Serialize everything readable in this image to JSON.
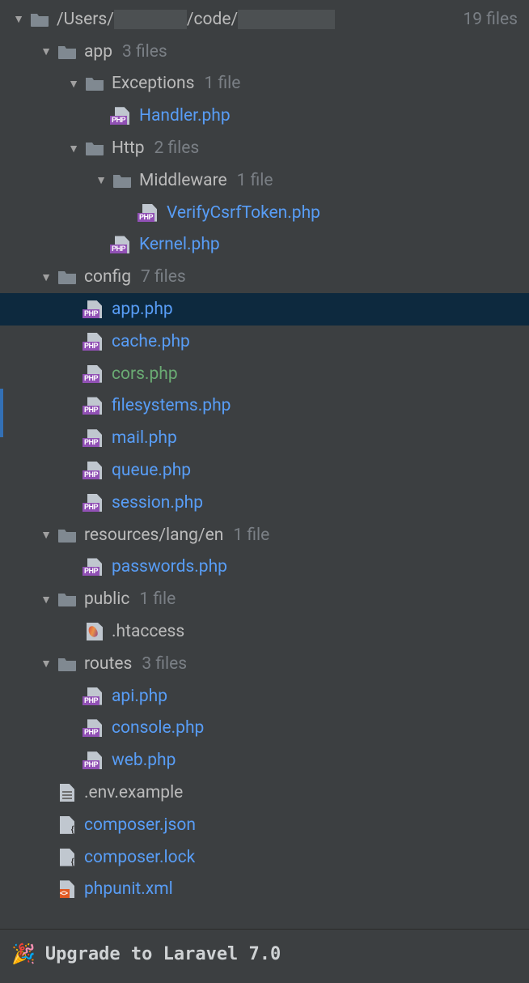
{
  "root": {
    "path_prefix": "/Users/",
    "path_mid": "/code/",
    "count": "19 files"
  },
  "tree": {
    "app": {
      "label": "app",
      "count": "3 files",
      "exceptions": {
        "label": "Exceptions",
        "count": "1 file",
        "handler": "Handler.php"
      },
      "http": {
        "label": "Http",
        "count": "2 files",
        "middleware": {
          "label": "Middleware",
          "count": "1 file",
          "verify": "VerifyCsrfToken.php"
        },
        "kernel": "Kernel.php"
      }
    },
    "config": {
      "label": "config",
      "count": "7 files",
      "app": "app.php",
      "cache": "cache.php",
      "cors": "cors.php",
      "filesystems": "filesystems.php",
      "mail": "mail.php",
      "queue": "queue.php",
      "session": "session.php"
    },
    "resources": {
      "label": "resources/lang/en",
      "count": "1 file",
      "passwords": "passwords.php"
    },
    "public": {
      "label": "public",
      "count": "1 file",
      "htaccess": ".htaccess"
    },
    "routes": {
      "label": "routes",
      "count": "3 files",
      "api": "api.php",
      "console": "console.php",
      "web": "web.php"
    },
    "env": ".env.example",
    "composer_json": "composer.json",
    "composer_lock": "composer.lock",
    "phpunit": "phpunit.xml"
  },
  "footer": {
    "text": "Upgrade to Laravel 7.0"
  }
}
